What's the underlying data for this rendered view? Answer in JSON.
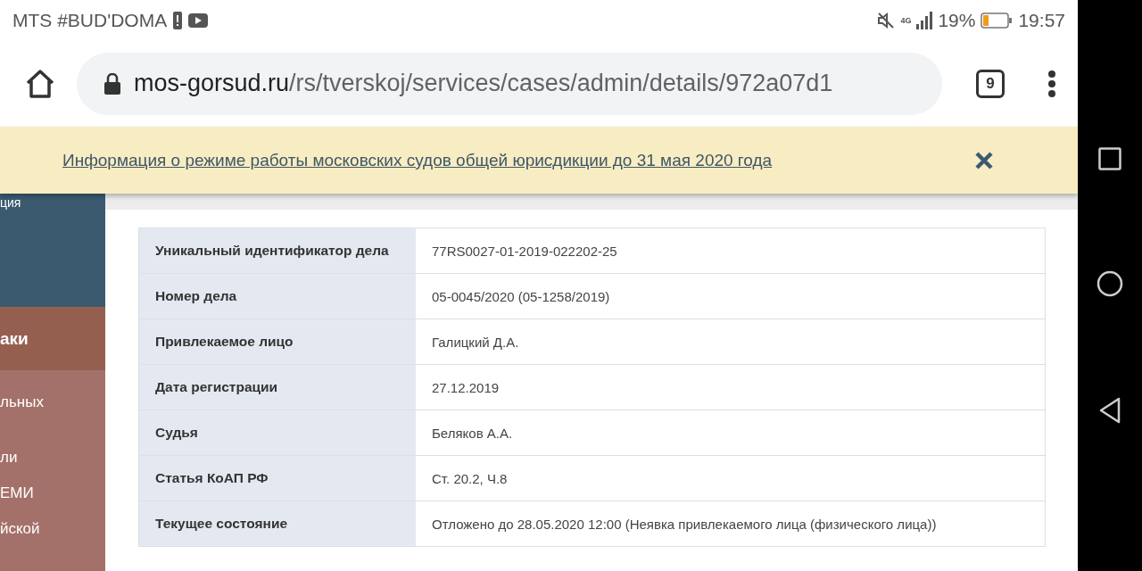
{
  "status_bar": {
    "carrier": "MTS #BUD'DOMA",
    "network": "4G",
    "battery_percent": "19%",
    "time": "19:57"
  },
  "browser": {
    "url_domain": "mos-gorsud.ru",
    "url_path": "/rs/tverskoj/services/cases/admin/details/972a07d1",
    "tab_count": "9"
  },
  "banner": {
    "link": "Информация о режиме работы московских судов общей юрисдикции до 31 мая 2020 года"
  },
  "sidebar": {
    "items": [
      {
        "label": "ция",
        "kind": "nav"
      },
      {
        "label": "аки",
        "kind": "header"
      },
      {
        "label": "льных",
        "kind": "link"
      },
      {
        "label": "ли",
        "kind": "link"
      },
      {
        "label": "ЕМИ",
        "kind": "link"
      },
      {
        "label": "йской",
        "kind": "link"
      }
    ]
  },
  "table": {
    "rows": [
      {
        "label": "Уникальный идентификатор дела",
        "value": "77RS0027-01-2019-022202-25"
      },
      {
        "label": "Номер дела",
        "value": "05-0045/2020 (05-1258/2019)"
      },
      {
        "label": "Привлекаемое лицо",
        "value": "Галицкий Д.А."
      },
      {
        "label": "Дата регистрации",
        "value": "27.12.2019"
      },
      {
        "label": "Судья",
        "value": "Беляков А.А."
      },
      {
        "label": "Статья КоАП РФ",
        "value": "Ст. 20.2, Ч.8"
      },
      {
        "label": "Текущее состояние",
        "value": "Отложено до 28.05.2020 12:00 (Неявка привлекаемого лица (физического лица))"
      }
    ]
  }
}
